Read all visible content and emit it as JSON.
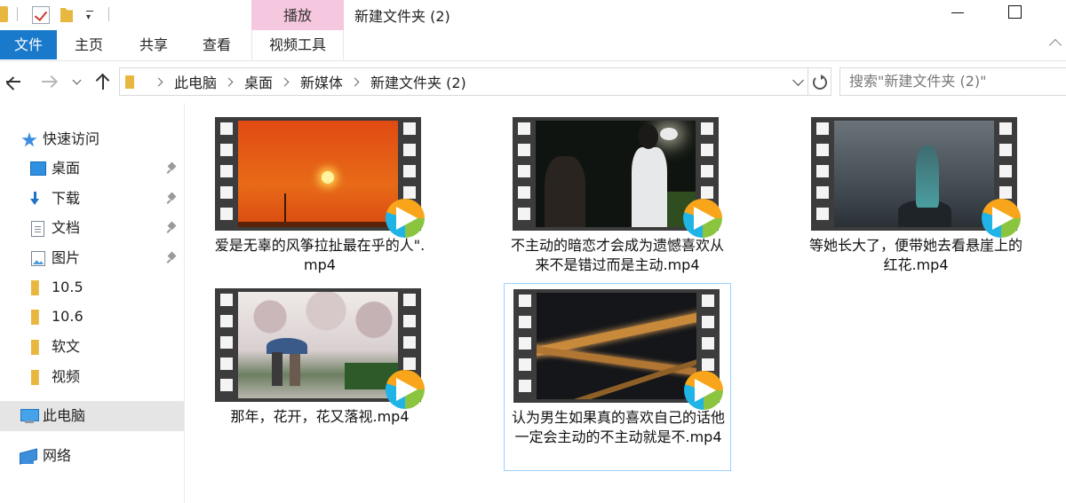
{
  "window": {
    "title": "新建文件夹 (2)",
    "context_tab": "播放"
  },
  "ribbon": {
    "tabs": [
      "文件",
      "主页",
      "共享",
      "查看",
      "视频工具"
    ]
  },
  "address": {
    "crumbs": [
      "此电脑",
      "桌面",
      "新媒体",
      "新建文件夹 (2)"
    ],
    "search_placeholder": "搜索\"新建文件夹 (2)\""
  },
  "sidebar": {
    "quick_access": "快速访问",
    "items": [
      {
        "label": "桌面",
        "icon": "desktop-folder-icon",
        "pinned": true
      },
      {
        "label": "下载",
        "icon": "downloads-folder-icon",
        "pinned": true
      },
      {
        "label": "文档",
        "icon": "documents-folder-icon",
        "pinned": true
      },
      {
        "label": "图片",
        "icon": "pictures-folder-icon",
        "pinned": true
      },
      {
        "label": "10.5",
        "icon": "folder-icon",
        "pinned": false
      },
      {
        "label": "10.6",
        "icon": "folder-icon",
        "pinned": false
      },
      {
        "label": "软文",
        "icon": "folder-icon",
        "pinned": false
      },
      {
        "label": "视频",
        "icon": "folder-icon",
        "pinned": false
      }
    ],
    "this_pc": "此电脑",
    "network": "网络"
  },
  "files": [
    {
      "name": "爱是无辜的风筝拉扯最在乎的人\".mp4",
      "thumbnail": "sunset"
    },
    {
      "name": "不主动的暗恋才会成为遗憾喜欢从来不是错过而是主动.mp4",
      "thumbnail": "night-street"
    },
    {
      "name": "等她长大了，便带她去看悬崖上的红花.mp4",
      "thumbnail": "foggy-cliff"
    },
    {
      "name": "那年，花开，花又落视.mp4",
      "thumbnail": "rainy-blossoms"
    },
    {
      "name": "认为男生如果真的喜欢自己的话他一定会主动的不主动就是不.mp4",
      "thumbnail": "night-overpass",
      "selected": true
    }
  ],
  "colors": {
    "file_tab": "#1979ca",
    "context_tab": "#f5c8df",
    "selection_border": "#99d1ff",
    "sidebar_selected": "#e5e5e5"
  }
}
